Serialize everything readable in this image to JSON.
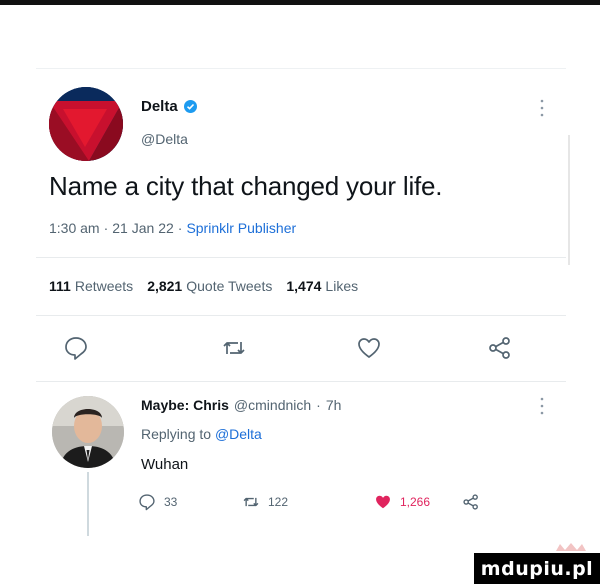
{
  "tweet": {
    "author_name": "Delta",
    "author_handle": "@Delta",
    "text": "Name a city that changed your life.",
    "time": "1:30 am",
    "date": "21 Jan 22",
    "source": "Sprinklr Publisher",
    "separator": "·",
    "stats": {
      "retweets_count": "111",
      "retweets_label": "Retweets",
      "quotes_count": "2,821",
      "quotes_label": "Quote Tweets",
      "likes_count": "1,474",
      "likes_label": "Likes"
    },
    "actions": [
      "reply-icon",
      "retweet-icon",
      "like-icon",
      "share-icon"
    ]
  },
  "reply": {
    "author_name": "Maybe: Chris",
    "author_handle": "@cmindnich",
    "separator": "·",
    "age": "7h",
    "replying_prefix": "Replying to",
    "replying_mention": "@Delta",
    "text": "Wuhan",
    "reply_count": "33",
    "retweet_count": "122",
    "like_count": "1,266",
    "liked_color": "#e0245e"
  },
  "colors": {
    "delta_red": "#c8102e",
    "delta_navy": "#0a2a5c",
    "link_blue": "#1d6fd8",
    "muted_gray": "#536471"
  },
  "watermark": {
    "text": "mdupiu.pl"
  }
}
